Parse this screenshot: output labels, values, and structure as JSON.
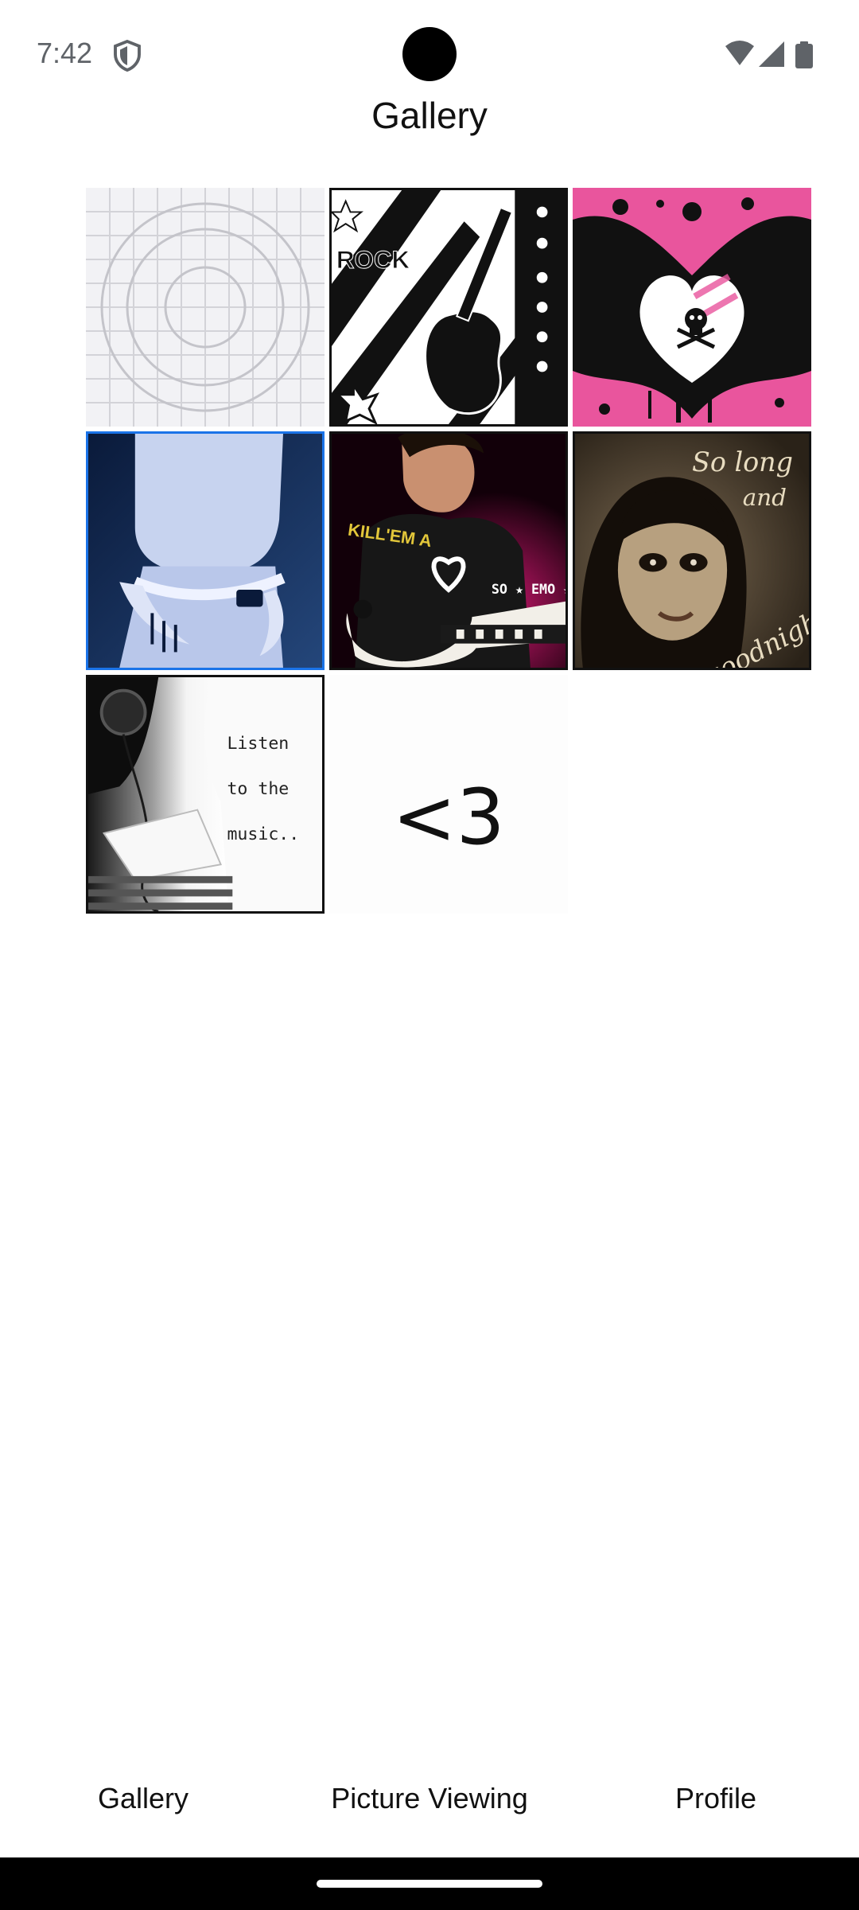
{
  "status": {
    "time": "7:42"
  },
  "header": {
    "title": "Gallery"
  },
  "gallery": {
    "images": [
      {
        "name": "placeholder-image",
        "caption": ""
      },
      {
        "name": "rock-guitar-image",
        "caption": "ROCK"
      },
      {
        "name": "pink-winged-heart-image",
        "caption": ""
      },
      {
        "name": "blue-belt-image",
        "caption": ""
      },
      {
        "name": "guitarist-so-emo-image",
        "caption": "SO ★ EMO ★",
        "shirt_text": "KILL'EM A"
      },
      {
        "name": "so-long-goodnight-image",
        "caption_top": "So long",
        "caption_mid": "and",
        "caption_bottom": "goodnight"
      },
      {
        "name": "listen-music-image",
        "line1": "Listen",
        "line2": "to the",
        "line3": "music.."
      },
      {
        "name": "heart-text-image",
        "caption": "<3"
      }
    ]
  },
  "bottom_nav": {
    "items": [
      {
        "label": "Gallery"
      },
      {
        "label": "Picture Viewing"
      },
      {
        "label": "Profile"
      }
    ]
  },
  "colors": {
    "accent": "#1a73e8",
    "pink": "#e9559d"
  }
}
